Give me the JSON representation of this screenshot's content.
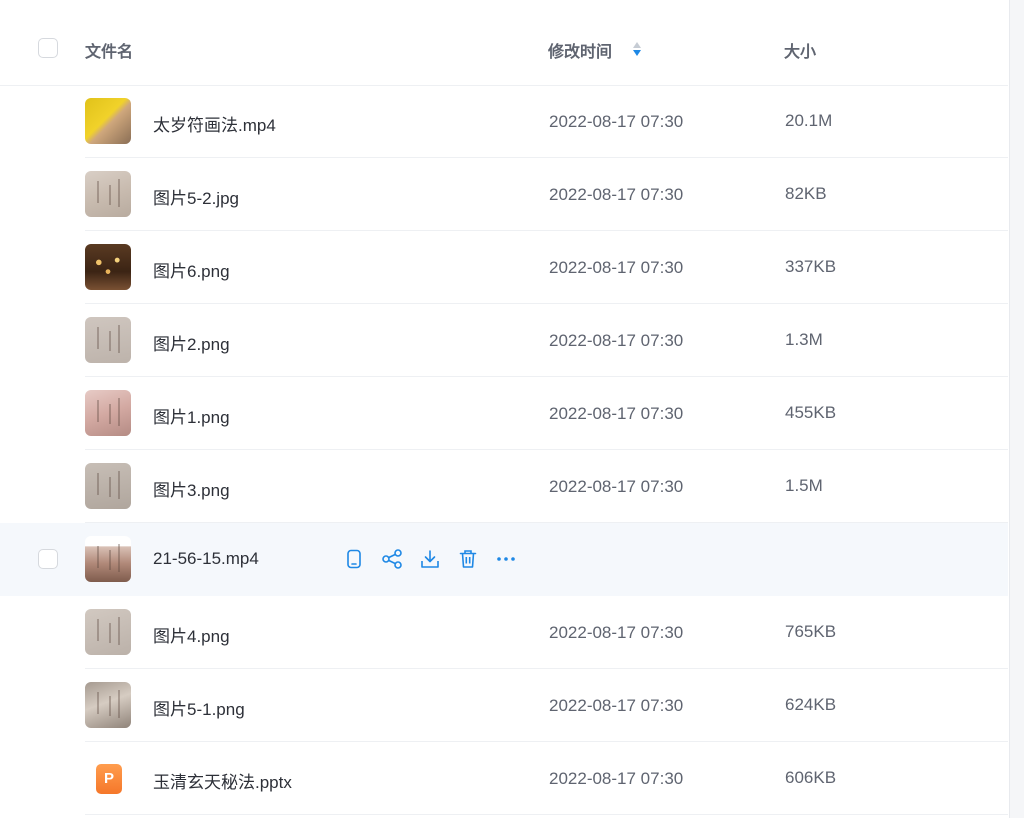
{
  "header": {
    "col_name": "文件名",
    "col_time": "修改时间",
    "col_size": "大小"
  },
  "colors": {
    "accent": "#1e88e5",
    "text_primary": "#2d3038",
    "text_secondary": "#5f6470",
    "hover_row": "#f5f8fc",
    "pptx_icon": "#f5772a"
  },
  "files": [
    {
      "name": "太岁符画法.mp4",
      "date": "2022-08-17 07:30",
      "size": "20.1M",
      "thumb": "yellow"
    },
    {
      "name": "图片5-2.jpg",
      "date": "2022-08-17 07:30",
      "size": "82KB",
      "thumb": "paper1"
    },
    {
      "name": "图片6.png",
      "date": "2022-08-17 07:30",
      "size": "337KB",
      "thumb": "dark"
    },
    {
      "name": "图片2.png",
      "date": "2022-08-17 07:30",
      "size": "1.3M",
      "thumb": "paper2"
    },
    {
      "name": "图片1.png",
      "date": "2022-08-17 07:30",
      "size": "455KB",
      "thumb": "pink"
    },
    {
      "name": "图片3.png",
      "date": "2022-08-17 07:30",
      "size": "1.5M",
      "thumb": "paper3"
    },
    {
      "name": "21-56-15.mp4",
      "date": "",
      "size": "",
      "thumb": "video",
      "hover": true
    },
    {
      "name": "图片4.png",
      "date": "2022-08-17 07:30",
      "size": "765KB",
      "thumb": "paper4"
    },
    {
      "name": "图片5-1.png",
      "date": "2022-08-17 07:30",
      "size": "624KB",
      "thumb": "paper5"
    },
    {
      "name": "玉清玄天秘法.pptx",
      "date": "2022-08-17 07:30",
      "size": "606KB",
      "thumb": "ppt"
    }
  ],
  "hover_actions": [
    {
      "name": "phone-icon"
    },
    {
      "name": "share-icon"
    },
    {
      "name": "download-icon"
    },
    {
      "name": "delete-icon"
    },
    {
      "name": "more-icon"
    }
  ],
  "ppt_icon_letter": "P"
}
